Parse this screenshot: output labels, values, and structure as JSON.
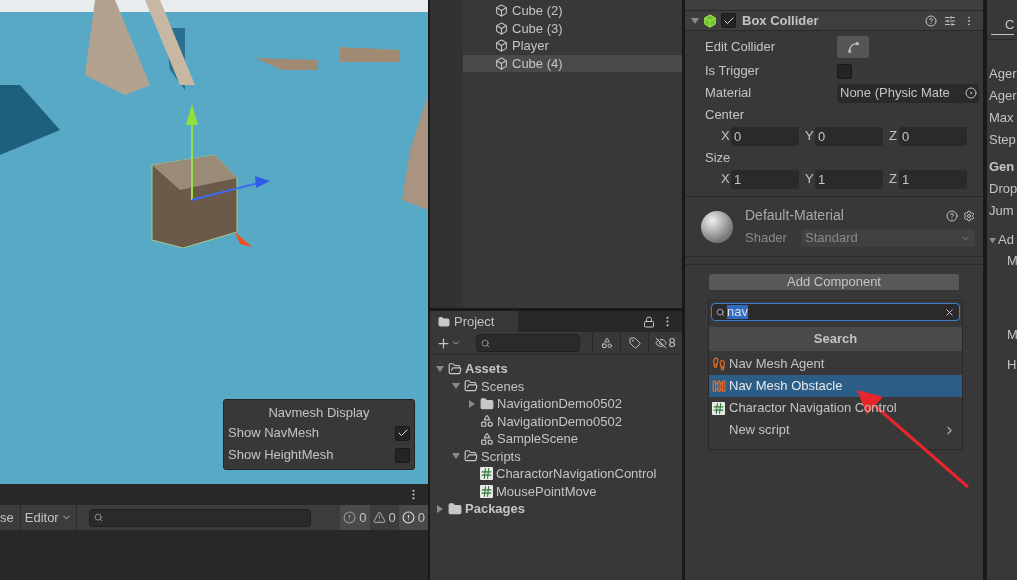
{
  "scene": {
    "navmesh_display": {
      "title": "Navmesh Display",
      "options": [
        {
          "label": "Show NavMesh",
          "checked": true
        },
        {
          "label": "Show HeightMesh",
          "checked": false
        }
      ]
    }
  },
  "console": {
    "tab_fragment": "se",
    "dropdown": "Editor",
    "counters": [
      {
        "kind": "info",
        "count": "0"
      },
      {
        "kind": "warning",
        "count": "0"
      },
      {
        "kind": "error",
        "count": "0"
      }
    ]
  },
  "hierarchy": {
    "items": [
      {
        "label": "Cube (2)",
        "selected": false
      },
      {
        "label": "Cube (3)",
        "selected": false
      },
      {
        "label": "Player",
        "selected": false
      },
      {
        "label": "Cube (4)",
        "selected": true
      }
    ]
  },
  "project": {
    "title": "Project",
    "hidden_count": "8",
    "tree": [
      {
        "label": "Assets",
        "kind": "folder",
        "expanded": true,
        "children": [
          {
            "label": "Scenes",
            "kind": "folder",
            "expanded": true,
            "children": [
              {
                "label": "NavigationDemo0502",
                "kind": "folder",
                "expanded": false
              },
              {
                "label": "NavigationDemo0502",
                "kind": "scene"
              },
              {
                "label": "SampleScene",
                "kind": "scene"
              }
            ]
          },
          {
            "label": "Scripts",
            "kind": "folder",
            "expanded": true,
            "children": [
              {
                "label": "CharactorNavigationControl",
                "kind": "script"
              },
              {
                "label": "MousePointMove",
                "kind": "script"
              }
            ]
          }
        ]
      },
      {
        "label": "Packages",
        "kind": "folder",
        "expanded": false
      }
    ]
  },
  "inspector": {
    "component": {
      "title": "Box Collider",
      "enabled": true,
      "fields": [
        {
          "kind": "button",
          "label": "Edit Collider"
        },
        {
          "kind": "checkbox",
          "label": "Is Trigger",
          "checked": false
        },
        {
          "kind": "object",
          "label": "Material",
          "value": "None (Physic Mate"
        },
        {
          "kind": "vector",
          "label": "Center",
          "values": [
            {
              "axis": "X",
              "value": "0"
            },
            {
              "axis": "Y",
              "value": "0"
            },
            {
              "axis": "Z",
              "value": "0"
            }
          ]
        },
        {
          "kind": "vector",
          "label": "Size",
          "values": [
            {
              "axis": "X",
              "value": "1"
            },
            {
              "axis": "Y",
              "value": "1"
            },
            {
              "axis": "Z",
              "value": "1"
            }
          ]
        }
      ]
    },
    "material": {
      "name": "Default-Material",
      "shader_label": "Shader",
      "shader": "Standard"
    },
    "add_component": "Add Component",
    "popup": {
      "search_value": "nav",
      "title": "Search",
      "items": [
        {
          "kind": "agent",
          "label": "Nav Mesh Agent",
          "selected": false
        },
        {
          "kind": "obstacle",
          "label": "Nav Mesh Obstacle",
          "selected": true
        },
        {
          "kind": "script",
          "label": "Charactor Navigation Control",
          "selected": false
        },
        {
          "kind": "submenu",
          "label": "New script",
          "selected": false
        }
      ]
    }
  },
  "side_panel": {
    "tab_fragment": "C",
    "rows": [
      {
        "kind": "label",
        "text": "Ager"
      },
      {
        "kind": "label",
        "text": "Ager"
      },
      {
        "kind": "label",
        "text": "Max"
      },
      {
        "kind": "label",
        "text": "Step"
      },
      {
        "kind": "header",
        "text": "Gen"
      },
      {
        "kind": "label",
        "text": "Drop"
      },
      {
        "kind": "label",
        "text": "Jum"
      },
      {
        "kind": "foldout",
        "text": "Ad"
      },
      {
        "kind": "sub",
        "text": "M"
      },
      {
        "kind": "sub",
        "text": "M"
      },
      {
        "kind": "sub",
        "text": "H"
      }
    ]
  }
}
